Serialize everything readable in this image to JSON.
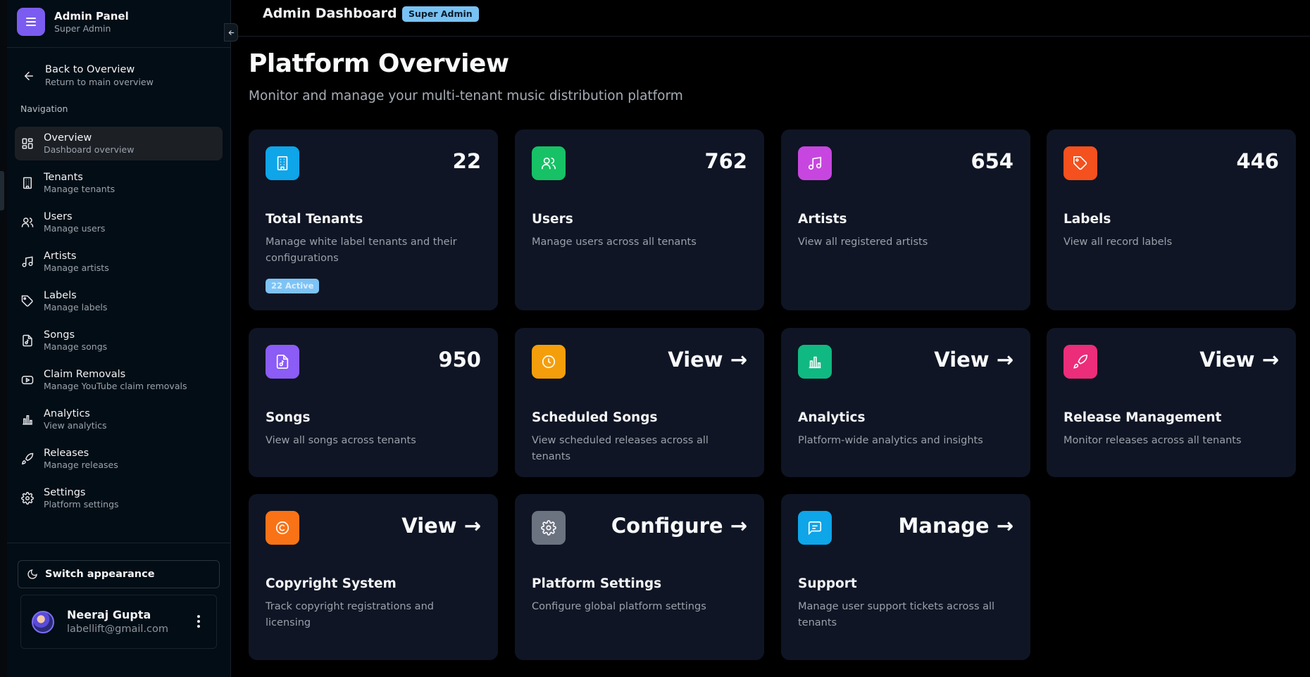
{
  "sidebar": {
    "brand_title": "Admin Panel",
    "brand_subtitle": "Super Admin",
    "back_title": "Back to Overview",
    "back_subtitle": "Return to main overview",
    "nav_heading": "Navigation",
    "items": [
      {
        "title": "Overview",
        "subtitle": "Dashboard overview",
        "icon": "grid-icon",
        "active": true
      },
      {
        "title": "Tenants",
        "subtitle": "Manage tenants",
        "icon": "building-icon"
      },
      {
        "title": "Users",
        "subtitle": "Manage users",
        "icon": "users-icon"
      },
      {
        "title": "Artists",
        "subtitle": "Manage artists",
        "icon": "music-note-icon"
      },
      {
        "title": "Labels",
        "subtitle": "Manage labels",
        "icon": "tag-icon"
      },
      {
        "title": "Songs",
        "subtitle": "Manage songs",
        "icon": "music-file-icon"
      },
      {
        "title": "Claim Removals",
        "subtitle": "Manage YouTube claim removals",
        "icon": "youtube-icon"
      },
      {
        "title": "Analytics",
        "subtitle": "View analytics",
        "icon": "bar-chart-icon"
      },
      {
        "title": "Releases",
        "subtitle": "Manage releases",
        "icon": "rocket-icon"
      },
      {
        "title": "Settings",
        "subtitle": "Platform settings",
        "icon": "gear-icon"
      }
    ],
    "appearance_label": "Switch appearance",
    "user": {
      "name": "Neeraj Gupta",
      "email": "labellift@gmail.com"
    }
  },
  "topbar": {
    "title": "Admin Dashboard",
    "badge": "Super Admin"
  },
  "main": {
    "title": "Platform Overview",
    "subtitle": "Monitor and manage your multi-tenant music distribution platform",
    "cards": [
      {
        "value": "22",
        "title": "Total Tenants",
        "description": "Manage white label tenants and their configurations",
        "badge": "22 Active",
        "icon": "building-icon",
        "color": "#0ea5e9"
      },
      {
        "value": "762",
        "title": "Users",
        "description": "Manage users across all tenants",
        "icon": "users-icon",
        "color": "#16c265"
      },
      {
        "value": "654",
        "title": "Artists",
        "description": "View all registered artists",
        "icon": "music-note-icon",
        "color": "#c746e0"
      },
      {
        "value": "446",
        "title": "Labels",
        "description": "View all record labels",
        "icon": "tag-icon",
        "color": "#f4511e"
      },
      {
        "value": "950",
        "title": "Songs",
        "description": "View all songs across tenants",
        "icon": "music-file-icon",
        "color": "#8b5cf6"
      },
      {
        "value": "View →",
        "title": "Scheduled Songs",
        "description": "View scheduled releases across all tenants",
        "icon": "clock-icon",
        "color": "#f59e0b"
      },
      {
        "value": "View →",
        "title": "Analytics",
        "description": "Platform-wide analytics and insights",
        "icon": "bar-chart-icon",
        "color": "#10b981"
      },
      {
        "value": "View →",
        "title": "Release Management",
        "description": "Monitor releases across all tenants",
        "icon": "rocket-icon",
        "color": "#ec2d7a"
      },
      {
        "value": "View →",
        "title": "Copyright System",
        "description": "Track copyright registrations and licensing",
        "icon": "copyright-icon",
        "color": "#f97316"
      },
      {
        "value": "Configure →",
        "title": "Platform Settings",
        "description": "Configure global platform settings",
        "icon": "gear-icon",
        "color": "#6b7280"
      },
      {
        "value": "Manage →",
        "title": "Support",
        "description": "Manage user support tickets across all tenants",
        "icon": "message-icon",
        "color": "#0ea5e9"
      }
    ]
  }
}
